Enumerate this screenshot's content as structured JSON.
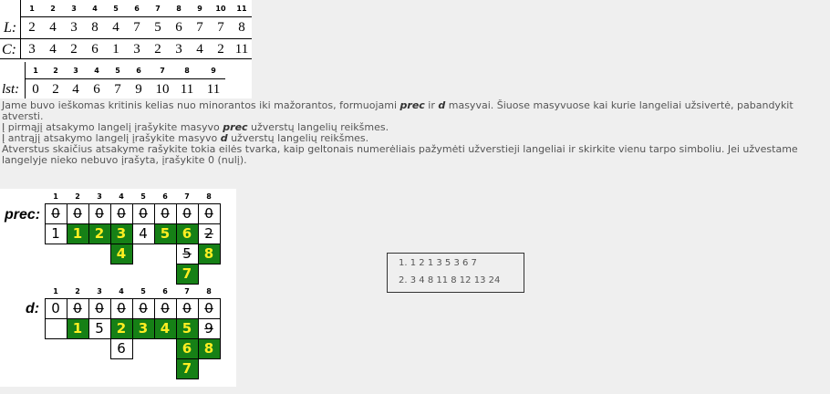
{
  "top_table": {
    "headers": [
      "1",
      "2",
      "3",
      "4",
      "5",
      "6",
      "7",
      "8",
      "9",
      "10",
      "11"
    ],
    "L_label": "L:",
    "L_values": [
      "2",
      "4",
      "3",
      "8",
      "4",
      "7",
      "5",
      "6",
      "7",
      "7",
      "8"
    ],
    "C_label": "C:",
    "C_values": [
      "3",
      "4",
      "2",
      "6",
      "1",
      "3",
      "2",
      "3",
      "4",
      "2",
      "11"
    ],
    "lst_headers": [
      "1",
      "2",
      "3",
      "4",
      "5",
      "6",
      "7",
      "8",
      "9"
    ],
    "lst_label": "lst:",
    "lst_values": [
      "0",
      "2",
      "4",
      "6",
      "7",
      "9",
      "10",
      "11",
      "11"
    ]
  },
  "instructions": {
    "p1_a": "Jame buvo ieškomas kritinis kelias nuo minorantos iki mažorantos, formuojami ",
    "p1_prec": "prec",
    "p1_b": " ir ",
    "p1_d": "d",
    "p1_c": " masyvai. Šiuose masyvuose kai kurie langeliai užsivertė, pabandykit atversti.",
    "p2_a": "Į pirmąjį atsakymo langelį įrašykite masyvo ",
    "p2_prec": "prec",
    "p2_b": " užverstų langelių reikšmes.",
    "p3_a": "Į antrąjį atsakymo langelį įrašykite masyvo ",
    "p3_d": "d",
    "p3_b": " užverstų langelių reikšmes.",
    "p4": "Atverstus skaičius atsakyme rašykite tokia eilės tvarka, kaip geltonais numerėliais pažymėti užverstieji langeliai ir skirkite vienu tarpo simboliu. Jei užvestame langelyje nieko nebuvo įrašyta, įrašykite 0 (nulį)."
  },
  "grid": {
    "headers": [
      "1",
      "2",
      "3",
      "4",
      "5",
      "6",
      "7",
      "8"
    ],
    "prec_label": "prec:",
    "d_label": "d:",
    "prec_row1": [
      "0",
      "0",
      "0",
      "0",
      "0",
      "0",
      "0",
      "0"
    ],
    "prec_row2": [
      "1",
      "1",
      "2",
      "3",
      "4",
      "5",
      "6",
      "2"
    ],
    "prec_row3_4": "4",
    "prec_row3_7": "5",
    "prec_row3_8": "8",
    "prec_row4_7": "7",
    "d_lead": "0",
    "d_row1": [
      "0",
      "0",
      "0",
      "0",
      "0",
      "0",
      "0"
    ],
    "d_row2": [
      "1",
      "5",
      "2",
      "3",
      "4",
      "5",
      "9"
    ],
    "d_row3_4": "6",
    "d_row3_7": "6",
    "d_row3_8": "8",
    "d_row4_7": "7"
  },
  "answers": {
    "n1": "1.",
    "v1": "1 2 1 3 5 3 6 7",
    "n2": "2.",
    "v2": "3 4 8 11 8 12 13 24"
  }
}
